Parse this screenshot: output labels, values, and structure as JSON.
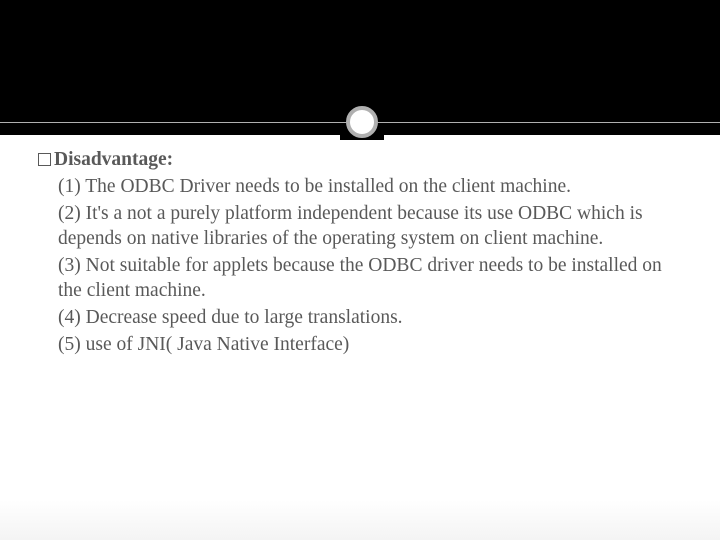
{
  "heading": "Disadvantage:",
  "points": [
    "(1)   The ODBC Driver needs to be installed on the client machine.",
    "(2)   It's a not a purely platform independent because its use ODBC which is depends on native libraries of the operating system on client machine.",
    "(3) Not suitable for applets because the ODBC driver needs to be installed on the client machine.",
    "(4) Decrease speed due to large translations.",
    "(5) use of JNI( Java Native Interface)"
  ]
}
